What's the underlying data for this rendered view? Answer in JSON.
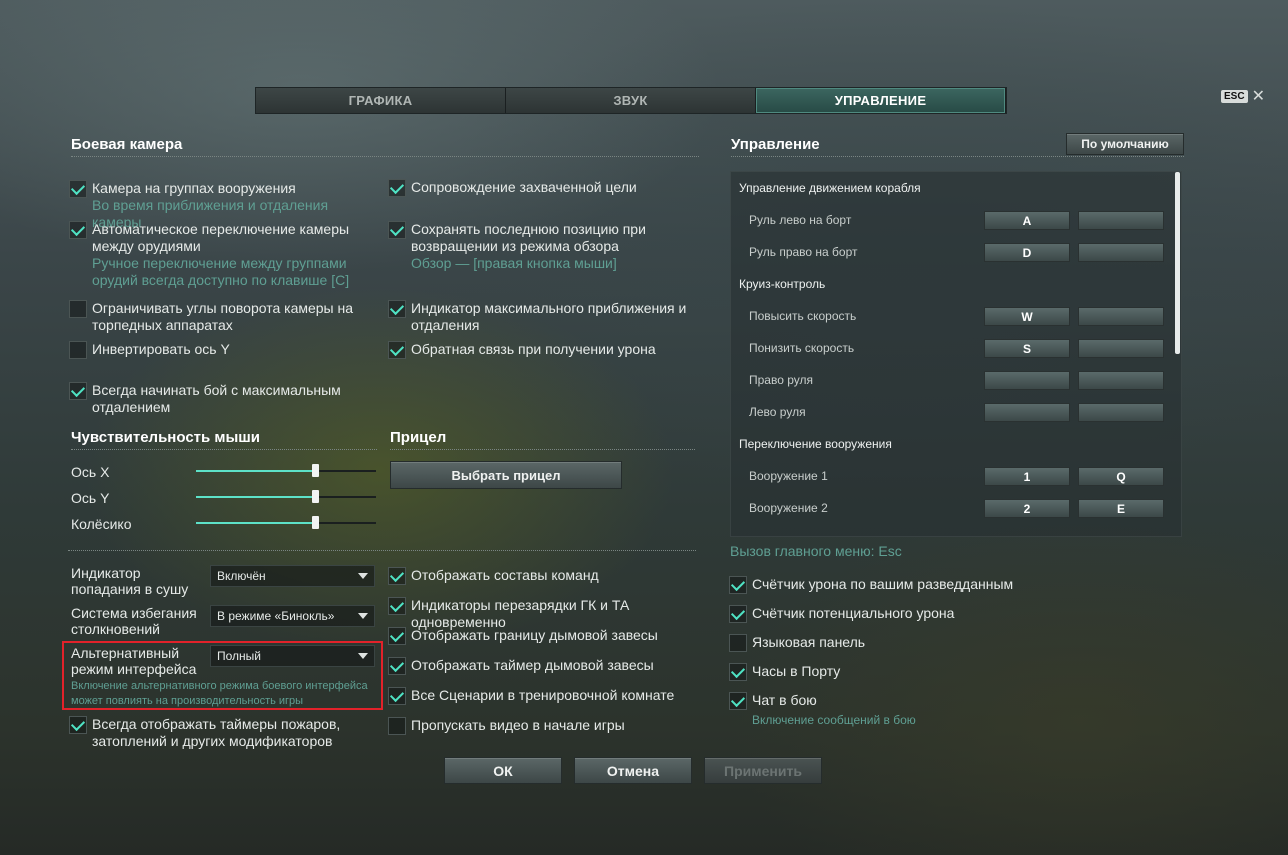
{
  "tabs": [
    "ГРАФИКА",
    "ЗВУК",
    "УПРАВЛЕНИЕ"
  ],
  "esc": {
    "key": "ESC",
    "close": "✕"
  },
  "camera": {
    "title": "Боевая камера",
    "left": [
      {
        "label": "Камера на группах вооружения",
        "sub": "Во время приближения и отдаления камеры",
        "checked": true
      },
      {
        "label": "Автоматическое переключение камеры между орудиями",
        "sub": "Ручное переключение между группами орудий всегда доступно по клавише [C]",
        "checked": true
      },
      {
        "label": "Ограничивать углы поворота камеры на торпедных аппаратах",
        "checked": false
      },
      {
        "label": "Инвертировать ось Y",
        "checked": false
      },
      {
        "label": "Всегда начинать бой с максимальным отдалением",
        "checked": true
      }
    ],
    "right": [
      {
        "label": "Сопровождение захваченной цели",
        "checked": true
      },
      {
        "label": "Сохранять последнюю позицию при возвращении из режима обзора",
        "sub": "Обзор — [правая кнопка мыши]",
        "checked": true
      },
      {
        "label": "Индикатор максимального приближения и отдаления",
        "checked": true
      },
      {
        "label": "Обратная связь при получении урона",
        "checked": true
      }
    ]
  },
  "mouse": {
    "title": "Чувствительность мыши",
    "sliders": [
      {
        "label": "Ось X",
        "value": 0.66
      },
      {
        "label": "Ось Y",
        "value": 0.66
      },
      {
        "label": "Колёсико",
        "value": 0.66
      }
    ]
  },
  "sight": {
    "title": "Прицел",
    "button": "Выбрать прицел"
  },
  "interface": {
    "selects": [
      {
        "label": "Индикатор попадания в сушу",
        "value": "Включён"
      },
      {
        "label": "Система избегания столкновений",
        "value": "В режиме «Бинокль»"
      },
      {
        "label": "Альтернативный режим интерфейса",
        "value": "Полный",
        "note": "Включение альтернативного режима боевого интерфейса может повлиять на производительность игры"
      }
    ],
    "timers": {
      "label": "Всегда отображать таймеры пожаров, затоплений и других модификаторов",
      "checked": true
    },
    "right": [
      {
        "label": "Отображать составы команд",
        "checked": true
      },
      {
        "label": "Индикаторы перезарядки ГК и ТА одновременно",
        "checked": true
      },
      {
        "label": "Отображать границу дымовой завесы",
        "checked": true
      },
      {
        "label": "Отображать таймер дымовой завесы",
        "checked": true
      },
      {
        "label": "Все Сценарии в тренировочной комнате",
        "checked": true
      },
      {
        "label": "Пропускать видео в начале игры",
        "checked": false
      }
    ]
  },
  "controls": {
    "title": "Управление",
    "default_button": "По умолчанию",
    "groups": [
      {
        "name": "Управление движением корабля",
        "items": [
          {
            "action": "Руль лево на борт",
            "k1": "A",
            "k2": ""
          },
          {
            "action": "Руль право на борт",
            "k1": "D",
            "k2": ""
          }
        ]
      },
      {
        "name": "Круиз-контроль",
        "items": [
          {
            "action": "Повысить скорость",
            "k1": "W",
            "k2": ""
          },
          {
            "action": "Понизить скорость",
            "k1": "S",
            "k2": ""
          },
          {
            "action": "Право руля",
            "k1": "",
            "k2": ""
          },
          {
            "action": "Лево руля",
            "k1": "",
            "k2": ""
          }
        ]
      },
      {
        "name": "Переключение вооружения",
        "items": [
          {
            "action": "Вооружение 1",
            "k1": "1",
            "k2": "Q"
          },
          {
            "action": "Вооружение 2",
            "k1": "2",
            "k2": "E"
          }
        ]
      }
    ],
    "menu_hint": "Вызов главного меню: Esc",
    "options": [
      {
        "label": "Счётчик урона по вашим разведданным",
        "checked": true
      },
      {
        "label": "Счётчик потенциального урона",
        "checked": true
      },
      {
        "label": "Языковая панель",
        "checked": false
      },
      {
        "label": "Часы в Порту",
        "checked": true
      },
      {
        "label": "Чат в бою",
        "sub": "Включение сообщений в бою",
        "checked": true
      }
    ]
  },
  "footer": {
    "ok": "ОК",
    "cancel": "Отмена",
    "apply": "Применить"
  }
}
